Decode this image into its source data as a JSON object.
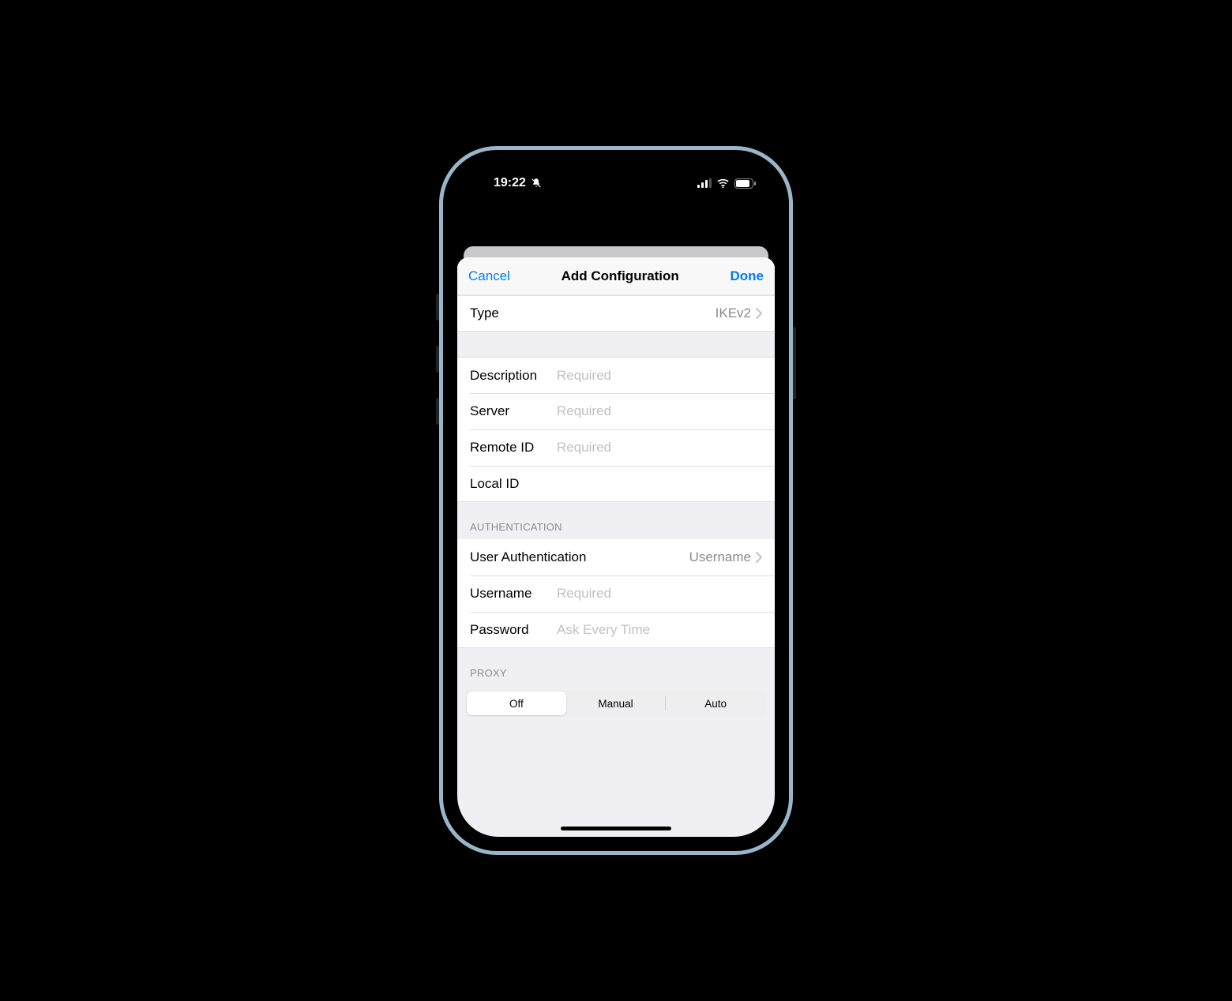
{
  "statusbar": {
    "time": "19:22"
  },
  "nav": {
    "cancel": "Cancel",
    "title": "Add Configuration",
    "done": "Done"
  },
  "type_row": {
    "label": "Type",
    "value": "IKEv2"
  },
  "details": {
    "description": {
      "label": "Description",
      "placeholder": "Required"
    },
    "server": {
      "label": "Server",
      "placeholder": "Required"
    },
    "remote_id": {
      "label": "Remote ID",
      "placeholder": "Required"
    },
    "local_id": {
      "label": "Local ID",
      "placeholder": ""
    }
  },
  "auth": {
    "header": "Authentication",
    "user_auth": {
      "label": "User Authentication",
      "value": "Username"
    },
    "username": {
      "label": "Username",
      "placeholder": "Required"
    },
    "password": {
      "label": "Password",
      "placeholder": "Ask Every Time"
    }
  },
  "proxy": {
    "header": "Proxy",
    "options": [
      "Off",
      "Manual",
      "Auto"
    ],
    "selected": "Off"
  }
}
